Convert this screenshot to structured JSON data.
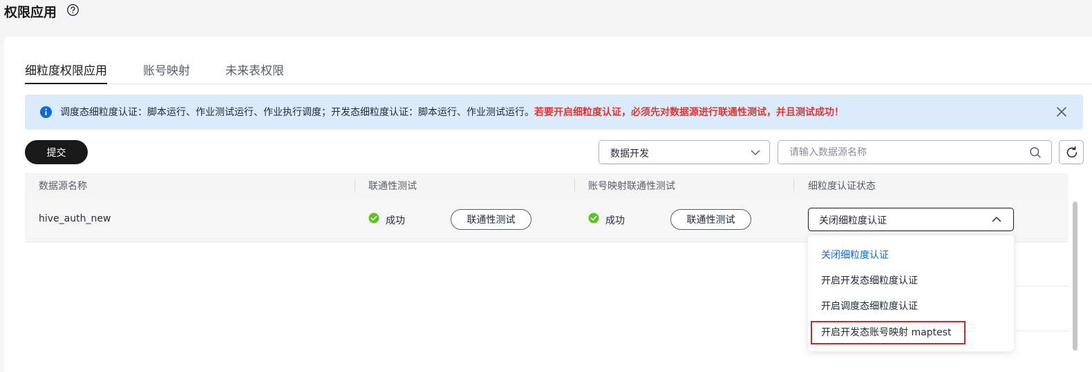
{
  "page": {
    "title": "权限应用",
    "help_icon": "question-circle-icon"
  },
  "tabs": [
    {
      "label": "细粒度权限应用",
      "active": true
    },
    {
      "label": "账号映射",
      "active": false
    },
    {
      "label": "未来表权限",
      "active": false
    }
  ],
  "alert": {
    "icon": "info-icon",
    "text": "调度态细粒度认证：脚本运行、作业测试运行、作业执行调度；开发态细粒度认证：脚本运行、作业测试运行。",
    "warning": "若要开启细粒度认证，必须先对数据源进行联通性测试，并且测试成功！",
    "close_icon": "close-icon"
  },
  "toolbar": {
    "submit_label": "提交",
    "filter_value": "数据开发",
    "search_placeholder": "请输入数据源名称",
    "refresh_icon": "refresh-icon"
  },
  "table": {
    "columns": [
      "数据源名称",
      "联通性测试",
      "账号映射联通性测试",
      "细粒度认证状态"
    ],
    "rows": [
      {
        "name": "hive_auth_new",
        "connectivity_status": "成功",
        "connectivity_button": "联通性测试",
        "mapping_status": "成功",
        "mapping_button": "联通性测试",
        "auth_state": "关闭细粒度认证"
      }
    ]
  },
  "dropdown": {
    "options": [
      {
        "label": "关闭细粒度认证",
        "selected": true
      },
      {
        "label": "开启开发态细粒度认证",
        "selected": false
      },
      {
        "label": "开启调度态细粒度认证",
        "selected": false
      },
      {
        "label": "开启开发态账号映射 maptest",
        "selected": false,
        "highlighted": true
      }
    ]
  },
  "colors": {
    "accent": "#191919",
    "link": "#0d6ad9",
    "success": "#5ac41e",
    "info": "#0d6ad9",
    "warning": "#e3352f",
    "alert_bg": "#dcebfc"
  }
}
